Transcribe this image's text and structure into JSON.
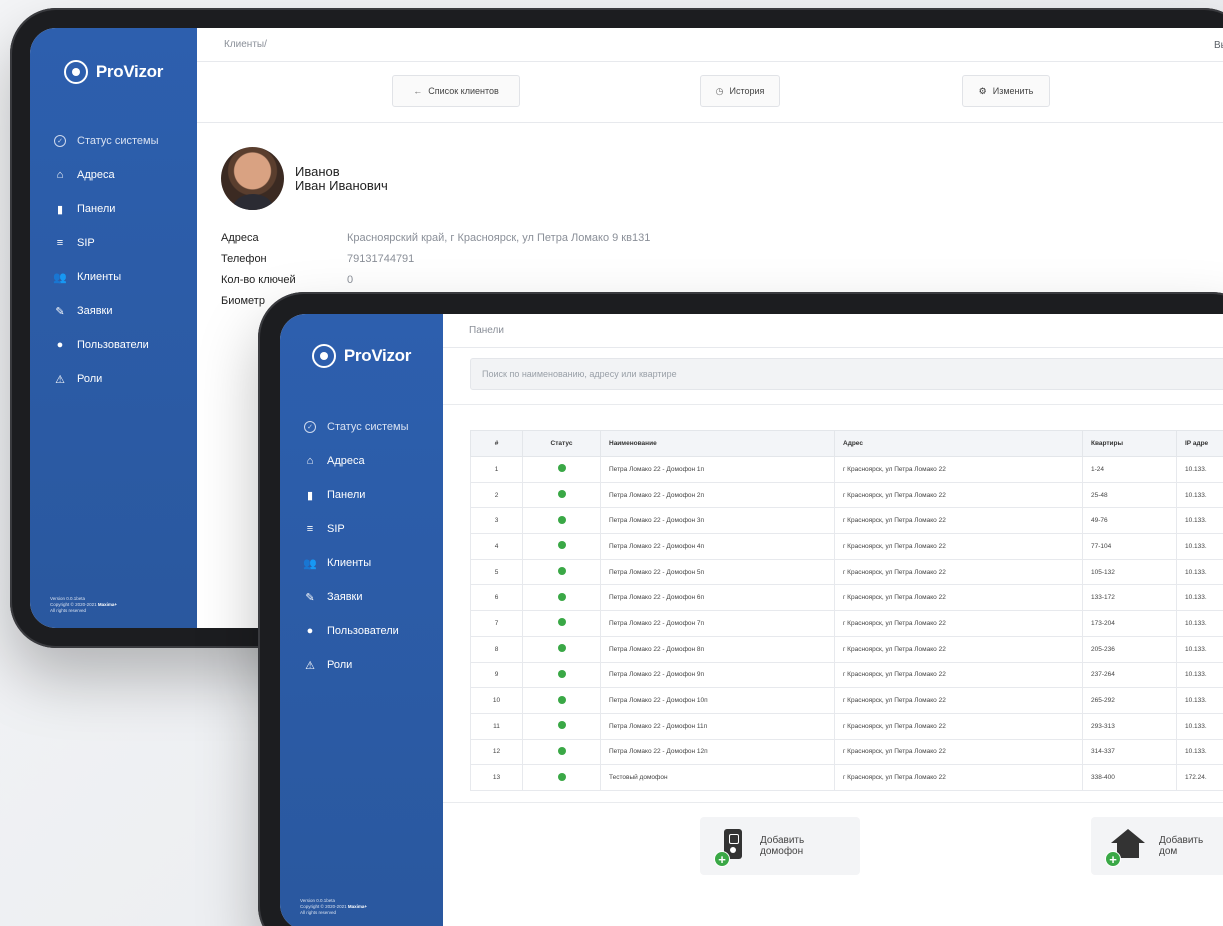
{
  "brand": {
    "name": "ProVizor"
  },
  "nav": [
    {
      "label": "Статус системы",
      "icon": "check-circle-icon"
    },
    {
      "label": "Адреса",
      "icon": "home-icon"
    },
    {
      "label": "Панели",
      "icon": "panel-icon"
    },
    {
      "label": "SIP",
      "icon": "list-icon"
    },
    {
      "label": "Клиенты",
      "icon": "users-icon"
    },
    {
      "label": "Заявки",
      "icon": "edit-icon"
    },
    {
      "label": "Пользователи",
      "icon": "user-icon"
    },
    {
      "label": "Роли",
      "icon": "roles-icon"
    }
  ],
  "footer": {
    "version": "Version 0.0.1beta",
    "copyright": "Copyright © 2020-2021",
    "company": "Maxima+",
    "rights": "All rights reserved"
  },
  "client": {
    "breadcrumb": "Клиенты/",
    "logout": "Выйт",
    "buttons": {
      "back": "Список клиентов",
      "history": "История",
      "edit": "Изменить"
    },
    "last_name": "Иванов",
    "first_middle": "Иван Иванович",
    "fields": [
      {
        "key": "Адреса",
        "value": "Красноярский край, г Красноярск, ул Петра Ломако 9 кв131"
      },
      {
        "key": "Телефон",
        "value": "79131744791"
      },
      {
        "key": "Кол-во ключей",
        "value": "0"
      },
      {
        "key": "Биометр",
        "value": ""
      }
    ]
  },
  "panels": {
    "breadcrumb": "Панели",
    "search_placeholder": "Поиск по наименованию, адресу или квартире",
    "columns": [
      "#",
      "Статус",
      "Наименование",
      "Адрес",
      "Квартиры",
      "IP адре"
    ],
    "status_color": "#3aa846",
    "rows": [
      {
        "n": "1",
        "name": "Петра Ломако 22 - Домофон 1п",
        "addr": "г Красноярск, ул Петра Ломако 22",
        "flats": "1-24",
        "ip": "10.133."
      },
      {
        "n": "2",
        "name": "Петра Ломако 22 - Домофон 2п",
        "addr": "г Красноярск, ул Петра Ломако 22",
        "flats": "25-48",
        "ip": "10.133."
      },
      {
        "n": "3",
        "name": "Петра Ломако 22 - Домофон 3п",
        "addr": "г Красноярск, ул Петра Ломако 22",
        "flats": "49-76",
        "ip": "10.133."
      },
      {
        "n": "4",
        "name": "Петра Ломако 22 - Домофон 4п",
        "addr": "г Красноярск, ул Петра Ломако 22",
        "flats": "77-104",
        "ip": "10.133."
      },
      {
        "n": "5",
        "name": "Петра Ломако 22 - Домофон 5п",
        "addr": "г Красноярск, ул Петра Ломако 22",
        "flats": "105-132",
        "ip": "10.133."
      },
      {
        "n": "6",
        "name": "Петра Ломако 22 - Домофон 6п",
        "addr": "г Красноярск, ул Петра Ломако 22",
        "flats": "133-172",
        "ip": "10.133."
      },
      {
        "n": "7",
        "name": "Петра Ломако 22 - Домофон 7п",
        "addr": "г Красноярск, ул Петра Ломако 22",
        "flats": "173-204",
        "ip": "10.133."
      },
      {
        "n": "8",
        "name": "Петра Ломако 22 - Домофон 8п",
        "addr": "г Красноярск, ул Петра Ломако 22",
        "flats": "205-236",
        "ip": "10.133."
      },
      {
        "n": "9",
        "name": "Петра Ломако 22 - Домофон 9п",
        "addr": "г Красноярск, ул Петра Ломако 22",
        "flats": "237-264",
        "ip": "10.133."
      },
      {
        "n": "10",
        "name": "Петра Ломако 22 - Домофон 10п",
        "addr": "г Красноярск, ул Петра Ломако 22",
        "flats": "265-292",
        "ip": "10.133."
      },
      {
        "n": "11",
        "name": "Петра Ломако 22 - Домофон 11п",
        "addr": "г Красноярск, ул Петра Ломако 22",
        "flats": "293-313",
        "ip": "10.133."
      },
      {
        "n": "12",
        "name": "Петра Ломако 22 - Домофон 12п",
        "addr": "г Красноярск, ул Петра Ломако 22",
        "flats": "314-337",
        "ip": "10.133."
      },
      {
        "n": "13",
        "name": "Тестовый домофон",
        "addr": "г Красноярск, ул Петра Ломако 22",
        "flats": "338-400",
        "ip": "172.24."
      }
    ],
    "add_intercom": [
      "Добавить",
      "домофон"
    ],
    "add_house": [
      "Добавить",
      "дом"
    ]
  }
}
